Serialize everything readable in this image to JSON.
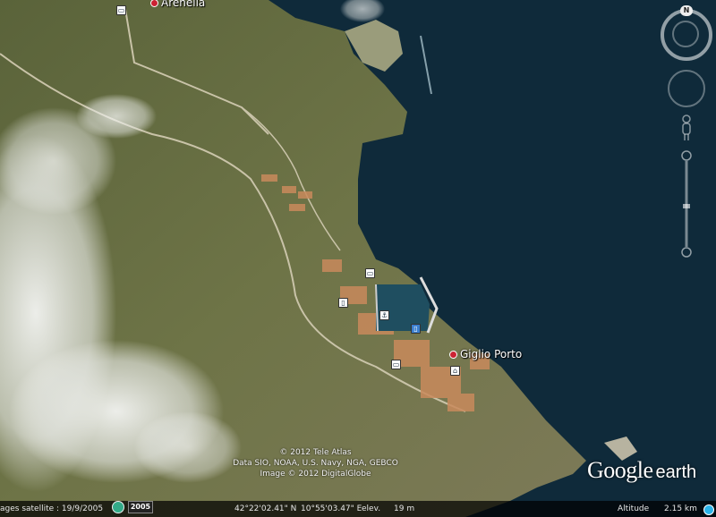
{
  "map": {
    "places": [
      {
        "name": "Arenella"
      },
      {
        "name": "Giglio Porto"
      }
    ]
  },
  "attribution": {
    "lines": [
      "© 2012 Tele Atlas",
      "Data SIO, NOAA, U.S. Navy, NGA, GEBCO",
      "Image © 2012 DigitalGlobe"
    ]
  },
  "logo": {
    "google": "Google",
    "earth": "earth"
  },
  "statusbar": {
    "imagery_date": "ages satellite : 19/9/2005",
    "year_badge": "2005",
    "lat": "42°22'02.41\" N",
    "lon": "10°55'03.47\" E",
    "elev_label": "elev.",
    "elev_value": "19 m",
    "altitude_label": "Altitude",
    "altitude_value": "2.15 km"
  },
  "navigation": {
    "north_label": "N"
  },
  "colors": {
    "sea": "#0f2a3a",
    "land_dark": "#3e4a28",
    "land_light": "#8d8f6a",
    "cloud": "#e8ecee",
    "statusbar": "#000000"
  },
  "icons": [
    "hotel-icon",
    "museum-icon",
    "bus-icon",
    "harbor-icon",
    "place-pin-icon",
    "pegman-icon",
    "zoom-slider-icon",
    "compass-icon"
  ]
}
